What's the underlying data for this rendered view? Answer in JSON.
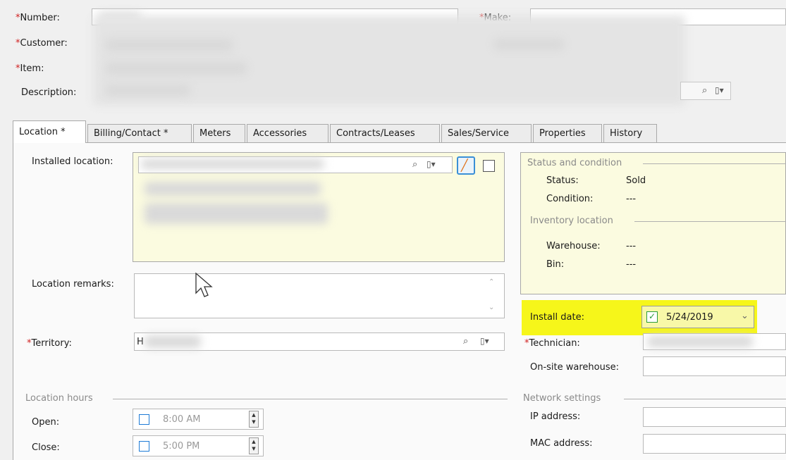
{
  "header": {
    "number_label": "Number:",
    "make_label": "Make:",
    "customer_label": "Customer:",
    "item_label": "Item:",
    "description_label": "Description:"
  },
  "tabs": [
    {
      "label": "Location *"
    },
    {
      "label": "Billing/Contact *"
    },
    {
      "label": "Meters"
    },
    {
      "label": "Accessories"
    },
    {
      "label": "Contracts/Leases"
    },
    {
      "label": "Sales/Service"
    },
    {
      "label": "Properties"
    },
    {
      "label": "History"
    }
  ],
  "location": {
    "installed_location_label": "Installed location:",
    "location_remarks_label": "Location remarks:",
    "territory_label": "Territory:",
    "territory_value": "H"
  },
  "status": {
    "group_title": "Status and condition",
    "status_label": "Status:",
    "status_value": "Sold",
    "condition_label": "Condition:",
    "condition_value": "---",
    "inventory_title": "Inventory location",
    "warehouse_label": "Warehouse:",
    "warehouse_value": "---",
    "bin_label": "Bin:",
    "bin_value": "---"
  },
  "install": {
    "label": "Install date:",
    "value": "5/24/2019",
    "checked": true
  },
  "technician": {
    "label": "Technician:",
    "onsite_label": "On-site warehouse:"
  },
  "hours": {
    "group_title": "Location hours",
    "open_label": "Open:",
    "open_value": "8:00 AM",
    "close_label": "Close:",
    "close_value": "5:00 PM"
  },
  "network": {
    "group_title": "Network settings",
    "ip_label": "IP address:",
    "mac_label": "MAC address:"
  },
  "icons": {
    "search": "search-icon",
    "lookup": "lookup-menu-icon",
    "edit": "pencil-icon"
  }
}
